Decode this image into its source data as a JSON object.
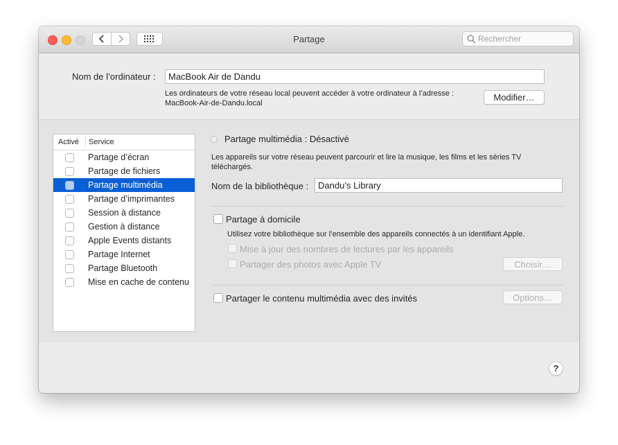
{
  "window": {
    "title": "Partage",
    "search_placeholder": "Rechercher"
  },
  "computer": {
    "name_label": "Nom de l’ordinateur :",
    "name_value": "MacBook Air de Dandu",
    "info_line1": "Les ordinateurs de votre réseau local peuvent accéder à votre ordinateur à l’adresse :",
    "info_line2": "MacBook-Air-de-Dandu.local",
    "edit_button": "Modifier…"
  },
  "services": {
    "header_enabled": "Activé",
    "header_service": "Service",
    "items": [
      {
        "label": "Partage d’écran",
        "enabled": false,
        "selected": false
      },
      {
        "label": "Partage de fichiers",
        "enabled": false,
        "selected": false
      },
      {
        "label": "Partage multimédia",
        "enabled": false,
        "selected": true
      },
      {
        "label": "Partage d’imprimantes",
        "enabled": false,
        "selected": false
      },
      {
        "label": "Session à distance",
        "enabled": false,
        "selected": false
      },
      {
        "label": "Gestion à distance",
        "enabled": false,
        "selected": false
      },
      {
        "label": "Apple Events distants",
        "enabled": false,
        "selected": false
      },
      {
        "label": "Partage Internet",
        "enabled": false,
        "selected": false
      },
      {
        "label": "Partage Bluetooth",
        "enabled": false,
        "selected": false
      },
      {
        "label": "Mise en cache de contenu",
        "enabled": false,
        "selected": false
      }
    ]
  },
  "detail": {
    "status": "Partage multimédia : Désactivé",
    "description_line1": "Les appareils sur votre réseau peuvent parcourir et lire la musique, les films et les séries TV",
    "description_line2": "téléchargés.",
    "library_label": "Nom de la bibliothèque :",
    "library_value": "Dandu’s Library",
    "home_sharing_label": "Partage à domicile",
    "home_sharing_desc": "Utilisez votre bibliothèque sur l’ensemble des appareils connectés à un identifiant Apple.",
    "update_counts_label": "Mise à jour des nombres de lectures par les appareils",
    "share_photos_label": "Partager des photos avec Apple TV",
    "choose_button": "Choisir…",
    "guests_label": "Partager le contenu multimédia avec des invités",
    "options_button": "Options…"
  },
  "help_label": "?"
}
